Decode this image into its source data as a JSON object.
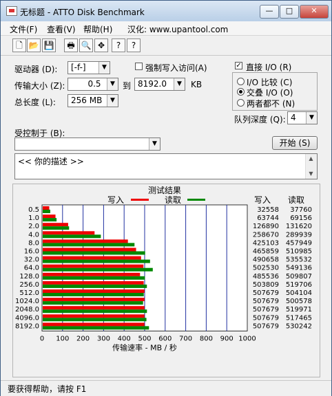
{
  "window": {
    "title": "无标题 - ATTO Disk Benchmark",
    "buttons": {
      "minimize": "—",
      "maximize": "□",
      "close": "✕"
    }
  },
  "menu": {
    "file": "文件(F)",
    "view": "查看(V)",
    "help": "帮助(H)",
    "info": "汉化: www.upantool.com"
  },
  "toolbar": {
    "icons": [
      "new-icon",
      "open-icon",
      "save-icon",
      "print-icon",
      "print-preview-icon",
      "move-icon",
      "help-icon",
      "context-help-icon"
    ],
    "glyphs": [
      "🗋",
      "📂",
      "💾",
      "🖶",
      "🔍",
      "✥",
      "?",
      "?"
    ]
  },
  "settings": {
    "drive_label": "驱动器 (D):",
    "drive_value": "[-f-]",
    "force_write_label": "强制写入访问(A)",
    "transfer_label": "传输大小 (Z):",
    "transfer_from": "0.5",
    "to_label": "到",
    "transfer_to": "8192.0",
    "kb_label": "KB",
    "length_label": "总长度 (L):",
    "length_value": "256 MB",
    "direct_io_label": "直接 I/O (R)",
    "io_compare_label": "I/O 比较 (C)",
    "overlap_io_label": "交叠 I/O (O)",
    "neither_label": "两者都不 (N)",
    "queue_label": "队列深度 (Q):",
    "queue_value": "4",
    "controlled_label": "受控制于 (B):",
    "controlled_value": "",
    "start_button": "开始 (S)",
    "description": "<<  你的描述  >>"
  },
  "results": {
    "title": "测试结果",
    "legend_write": "写入",
    "legend_read": "读取",
    "col_write": "写入",
    "col_read": "读取",
    "write_color": "#ee0000",
    "read_color": "#008800"
  },
  "chart_data": {
    "type": "bar",
    "orientation": "horizontal",
    "categories": [
      "0.5",
      "1.0",
      "2.0",
      "4.0",
      "8.0",
      "16.0",
      "32.0",
      "64.0",
      "128.0",
      "256.0",
      "512.0",
      "1024.0",
      "2048.0",
      "4096.0",
      "8192.0"
    ],
    "series": [
      {
        "name": "写入",
        "values": [
          32558,
          63744,
          126890,
          258670,
          425103,
          465859,
          490658,
          502530,
          485536,
          503809,
          507679,
          507679,
          507679,
          507679,
          507679
        ]
      },
      {
        "name": "读取",
        "values": [
          37760,
          69156,
          131620,
          289939,
          457949,
          510985,
          535532,
          549136,
          509807,
          519706,
          504104,
          500578,
          519971,
          517465,
          530242
        ]
      }
    ],
    "x_ticks": [
      "0",
      "100",
      "200",
      "300",
      "400",
      "500",
      "600",
      "700",
      "800",
      "900",
      "1000"
    ],
    "xlabel": "传输速率 - MB / 秒",
    "xlim": [
      0,
      1000
    ],
    "grid": true
  },
  "status": {
    "text": "要获得帮助，请按 F1"
  }
}
